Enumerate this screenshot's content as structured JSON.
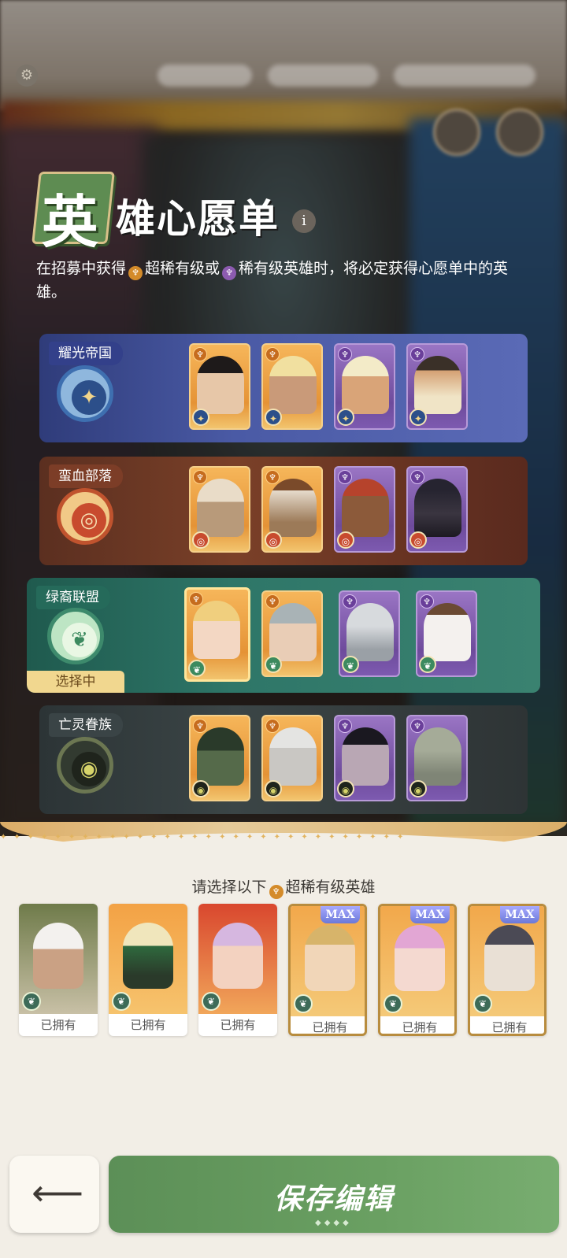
{
  "header": {
    "title_first": "英",
    "title_rest": "雄心愿单",
    "info_glyph": "i",
    "description_part1": "在招募中获得",
    "description_rare1": "超稀有级或",
    "description_rare2": "稀有级英雄时，将必定获得心愿单中的英雄。"
  },
  "factions": [
    {
      "name": "耀光帝国",
      "emblem": "star-emblem-icon"
    },
    {
      "name": "蛮血部落",
      "emblem": "target-emblem-icon"
    },
    {
      "name": "绿裔联盟",
      "emblem": "leaf-emblem-icon",
      "selected_label": "选择中"
    },
    {
      "name": "亡灵眷族",
      "emblem": "eye-emblem-icon"
    }
  ],
  "picker": {
    "title_prefix": "请选择以下",
    "title_suffix": "超稀有级英雄",
    "owned_label": "已拥有",
    "max_label": "MAX",
    "cards_owned": [
      "已拥有",
      "已拥有",
      "已拥有",
      "已拥有",
      "已拥有",
      "已拥有"
    ],
    "max_flags": [
      "",
      "",
      "",
      "MAX",
      "MAX",
      "MAX"
    ]
  },
  "footer": {
    "back_glyph": "⟵",
    "save_label": "保存编辑"
  },
  "colors": {
    "accent_green": "#6aa062",
    "gold_rarity": "#e59336",
    "purple_rarity": "#6e4b9c"
  }
}
